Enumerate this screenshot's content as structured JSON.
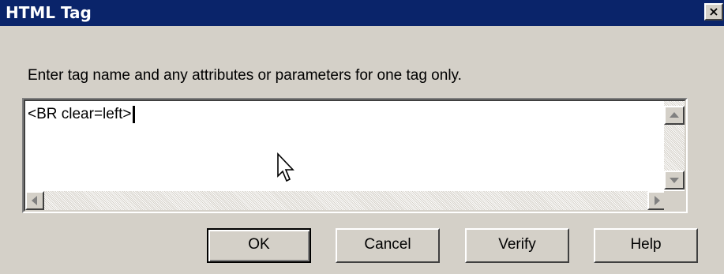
{
  "window": {
    "title": "HTML Tag",
    "close_symbol": "×"
  },
  "prompt": "Enter tag name and any attributes or parameters for one tag only.",
  "tag_input": {
    "value": "<BR clear=left>"
  },
  "buttons": {
    "ok": "OK",
    "cancel": "Cancel",
    "verify": "Verify",
    "help": "Help"
  },
  "icons": {
    "close": "close-icon",
    "scroll_up": "arrow-up-icon",
    "scroll_down": "arrow-down-icon",
    "scroll_left": "arrow-left-icon",
    "scroll_right": "arrow-right-icon",
    "cursor": "mouse-pointer-icon"
  },
  "colors": {
    "titlebar": "#0a246a",
    "dialog_face": "#d4d0c8",
    "field_bg": "#ffffff"
  }
}
